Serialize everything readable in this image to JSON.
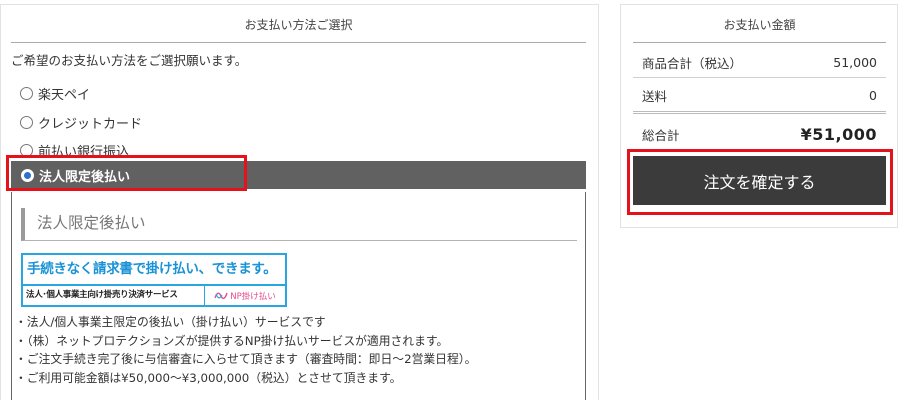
{
  "payment_method": {
    "title": "お支払い方法ご選択",
    "intro": "ご希望のお支払い方法をご選択願います。",
    "options": [
      {
        "label": "楽天ペイ",
        "selected": false
      },
      {
        "label": "クレジットカード",
        "selected": false
      },
      {
        "label": "前払い銀行振込",
        "selected": false
      },
      {
        "label": "法人限定後払い",
        "selected": true
      }
    ],
    "detail": {
      "heading": "法人限定後払い",
      "banner": {
        "headline": "手続きなく請求書で掛け払い、できます。",
        "subline": "法人･個人事業主向け掛売り決済サービス",
        "brand": "NP掛け払い",
        "brand_icon": "np-logo-icon"
      },
      "notes": [
        "・法人/個人事業主限定の後払い（掛け払い）サービスです",
        "・（株）ネットプロテクションズが提供するNP掛け払いサービスが適用されます。",
        "・ご注文手続き完了後に与信審査に入らせて頂きます（審査時間：即日～2営業日程）。",
        "・ご利用可能金額は¥50,000～¥3,000,000（税込）とさせて頂きます。"
      ]
    }
  },
  "summary": {
    "title": "お支払い金額",
    "subtotal_label": "商品合計（税込）",
    "subtotal_value": "51,000",
    "shipping_label": "送料",
    "shipping_value": "0",
    "total_label": "総合計",
    "total_value": "¥51,000",
    "order_button": "注文を確定する"
  },
  "colors": {
    "highlight": "#e5121b",
    "selected_bg": "#616161",
    "button_bg": "#3b3b3b",
    "banner_blue": "#29a6e0",
    "brand_pink": "#e44d8e"
  }
}
